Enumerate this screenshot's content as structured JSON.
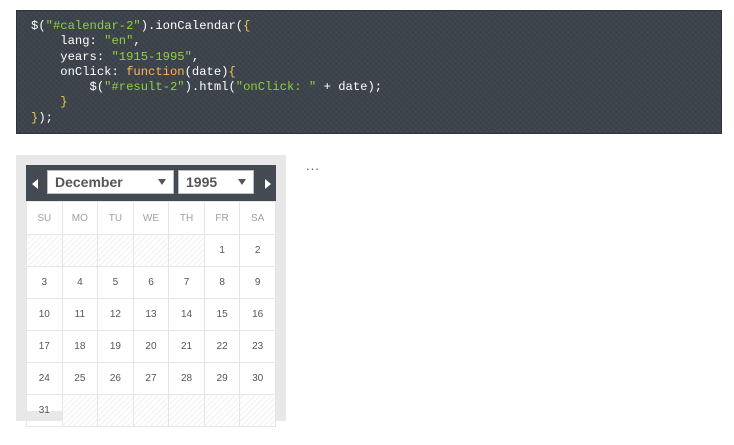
{
  "code": {
    "lines": [
      [
        {
          "t": "$(",
          "c": "pl"
        },
        {
          "t": "\"#calendar-2\"",
          "c": "str"
        },
        {
          "t": ").ionCalendar(",
          "c": "pl"
        },
        {
          "t": "{",
          "c": "brk"
        }
      ],
      [
        {
          "t": "    lang: ",
          "c": "pl"
        },
        {
          "t": "\"en\"",
          "c": "str"
        },
        {
          "t": ",",
          "c": "pl"
        }
      ],
      [
        {
          "t": "    years: ",
          "c": "pl"
        },
        {
          "t": "\"1915-1995\"",
          "c": "str"
        },
        {
          "t": ",",
          "c": "pl"
        }
      ],
      [
        {
          "t": "    onClick: ",
          "c": "pl"
        },
        {
          "t": "function",
          "c": "fn"
        },
        {
          "t": "(date)",
          "c": "pl"
        },
        {
          "t": "{",
          "c": "brk"
        }
      ],
      [
        {
          "t": "        $(",
          "c": "pl"
        },
        {
          "t": "\"#result-2\"",
          "c": "str"
        },
        {
          "t": ").html(",
          "c": "pl"
        },
        {
          "t": "\"onClick: \"",
          "c": "str"
        },
        {
          "t": " + date);",
          "c": "pl"
        }
      ],
      [
        {
          "t": "    }",
          "c": "brk"
        }
      ],
      [
        {
          "t": "}",
          "c": "brk"
        },
        {
          "t": ");",
          "c": "pl"
        }
      ]
    ]
  },
  "result": {
    "text": "..."
  },
  "calendar": {
    "month": "December",
    "year": "1995",
    "weekdays": [
      "SU",
      "MO",
      "TU",
      "WE",
      "TH",
      "FR",
      "SA"
    ],
    "weeks": [
      [
        "",
        "",
        "",
        "",
        "",
        "1",
        "2"
      ],
      [
        "3",
        "4",
        "5",
        "6",
        "7",
        "8",
        "9"
      ],
      [
        "10",
        "11",
        "12",
        "13",
        "14",
        "15",
        "16"
      ],
      [
        "17",
        "18",
        "19",
        "20",
        "21",
        "22",
        "23"
      ],
      [
        "24",
        "25",
        "26",
        "27",
        "28",
        "29",
        "30"
      ],
      [
        "31",
        "",
        "",
        "",
        "",
        "",
        ""
      ]
    ]
  },
  "icons": {
    "prev": "arrow-left-icon",
    "next": "arrow-right-icon",
    "dropdown": "chevron-down-icon"
  },
  "colors": {
    "code_bg": "#3d434c",
    "string": "#8fd13b",
    "bracket": "#e8c84e",
    "keyword": "#ffb84d",
    "header": "#444a52"
  }
}
